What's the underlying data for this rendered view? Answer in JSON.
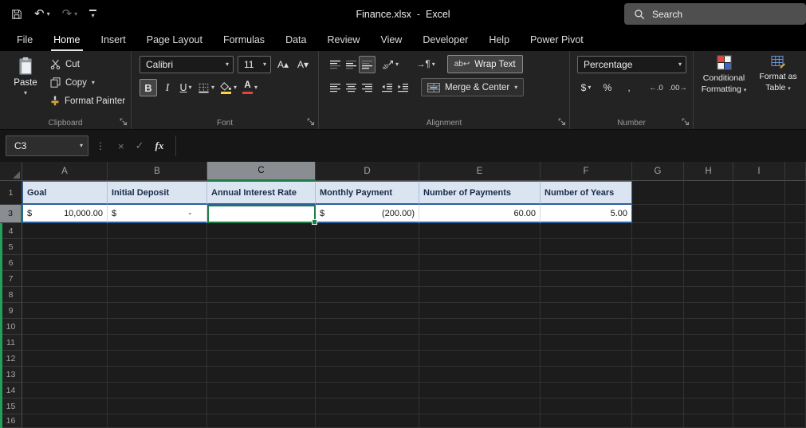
{
  "titlebar": {
    "title": "Finance.xlsx  -  Excel",
    "search": "Search"
  },
  "tabs": [
    {
      "label": "File",
      "active": false
    },
    {
      "label": "Home",
      "active": true
    },
    {
      "label": "Insert",
      "active": false
    },
    {
      "label": "Page Layout",
      "active": false
    },
    {
      "label": "Formulas",
      "active": false
    },
    {
      "label": "Data",
      "active": false
    },
    {
      "label": "Review",
      "active": false
    },
    {
      "label": "View",
      "active": false
    },
    {
      "label": "Developer",
      "active": false
    },
    {
      "label": "Help",
      "active": false
    },
    {
      "label": "Power Pivot",
      "active": false
    }
  ],
  "ribbon": {
    "clipboard": {
      "label": "Clipboard",
      "paste": "Paste",
      "cut": "Cut",
      "copy": "Copy",
      "format_painter": "Format Painter"
    },
    "font": {
      "label": "Font",
      "name": "Calibri",
      "size": "11"
    },
    "alignment": {
      "label": "Alignment",
      "wrap_text": "Wrap Text",
      "merge_center": "Merge & Center"
    },
    "number": {
      "label": "Number",
      "format": "Percentage"
    },
    "styles": {
      "conditional_formatting": "Conditional Formatting",
      "format_as_table": "Format as Table"
    }
  },
  "formula_bar": {
    "name_box": "C3",
    "formula": ""
  },
  "icons": {
    "chevron_down": "▾",
    "undo": "↶",
    "redo": "↷",
    "dots": "⋮",
    "cancel": "×",
    "enter": "✓",
    "fx": "fx",
    "bold": "B",
    "italic": "I",
    "underline": "U",
    "font_color_letter": "A",
    "grow_font": "A▴",
    "shrink_font": "A▾",
    "dollar": "$",
    "percent": "%",
    "comma": ",",
    "increase_decimal": "←.0",
    "decrease_decimal": ".00→",
    "wrap_ab": "ab↩",
    "text_direction": "→¶"
  },
  "sheet": {
    "columns": [
      "A",
      "B",
      "C",
      "D",
      "E",
      "F",
      "G",
      "H",
      "I",
      ""
    ],
    "selected_column": "C",
    "rows": [
      "1",
      "3",
      "4",
      "5",
      "6",
      "7",
      "8",
      "9",
      "10",
      "11",
      "12",
      "13",
      "14",
      "15",
      "16"
    ],
    "selected_row": "3",
    "selected_cell": "C3",
    "table": {
      "headers": [
        "Goal",
        "Initial Deposit",
        "Annual Interest Rate",
        "Monthly Payment",
        "Number of Payments",
        "Number of Years"
      ],
      "values": [
        {
          "col": "A",
          "prefix": "$",
          "text": "10,000.00"
        },
        {
          "col": "B",
          "prefix": "$",
          "text": "-"
        },
        {
          "col": "C",
          "prefix": "",
          "text": ""
        },
        {
          "col": "D",
          "prefix": "$",
          "text": "(200.00)"
        },
        {
          "col": "E",
          "prefix": "",
          "text": "60.00"
        },
        {
          "col": "F",
          "prefix": "",
          "text": "5.00"
        }
      ]
    }
  },
  "accent_colors": {
    "selection_green": "#1b7e46",
    "table_border_blue": "#2f5f9e",
    "table_header_fill": "#dbe5f2",
    "fill_color_yellow": "#ffd43b",
    "font_color_red": "#e8413c"
  }
}
